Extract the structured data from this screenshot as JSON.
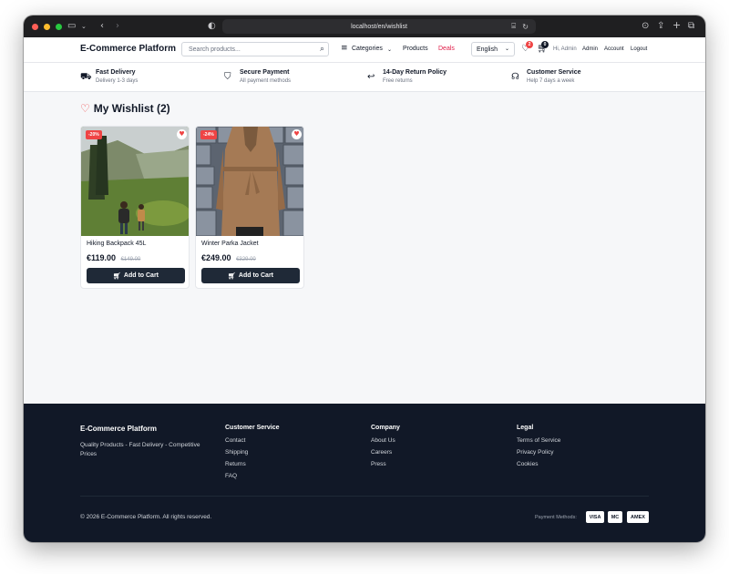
{
  "browser": {
    "url": "localhost/en/wishlist"
  },
  "header": {
    "brand": "E-Commerce Platform",
    "search_placeholder": "Search products...",
    "categories": "Categories",
    "products": "Products",
    "deals": "Deals",
    "language": "English",
    "wishlist_count": "2",
    "cart_count": "0",
    "greeting": "Hi, Admin",
    "admin": "Admin",
    "account": "Account",
    "logout": "Logout"
  },
  "features": [
    {
      "title": "Fast Delivery",
      "subtitle": "Delivery 1-3 days",
      "icon": "truck-icon"
    },
    {
      "title": "Secure Payment",
      "subtitle": "All payment methods",
      "icon": "shield-icon"
    },
    {
      "title": "14-Day Return Policy",
      "subtitle": "Free returns",
      "icon": "return-arrow-icon"
    },
    {
      "title": "Customer Service",
      "subtitle": "Help 7 days a week",
      "icon": "headset-icon"
    }
  ],
  "wishlist": {
    "title": "My Wishlist (2)",
    "items": [
      {
        "name": "Hiking Backpack 45L",
        "price": "€119.00",
        "old_price": "€149.00",
        "discount": "-20%",
        "button": "Add to Cart"
      },
      {
        "name": "Winter Parka Jacket",
        "price": "€249.00",
        "old_price": "€329.00",
        "discount": "-24%",
        "button": "Add to Cart"
      }
    ]
  },
  "footer": {
    "brand": "E-Commerce Platform",
    "tagline": "Quality Products - Fast Delivery - Competitive Prices",
    "columns": [
      {
        "title": "Customer Service",
        "links": [
          "Contact",
          "Shipping",
          "Returns",
          "FAQ"
        ]
      },
      {
        "title": "Company",
        "links": [
          "About Us",
          "Careers",
          "Press"
        ]
      },
      {
        "title": "Legal",
        "links": [
          "Terms of Service",
          "Privacy Policy",
          "Cookies"
        ]
      }
    ],
    "copyright": "© 2026 E-Commerce Platform. All rights reserved.",
    "payment_label": "Payment Methods:",
    "payment_methods": [
      "VISA",
      "MC",
      "AMEX"
    ]
  },
  "colors": {
    "accent_red": "#ef4444",
    "dark_button": "#1f2937",
    "footer_bg": "#111827"
  }
}
